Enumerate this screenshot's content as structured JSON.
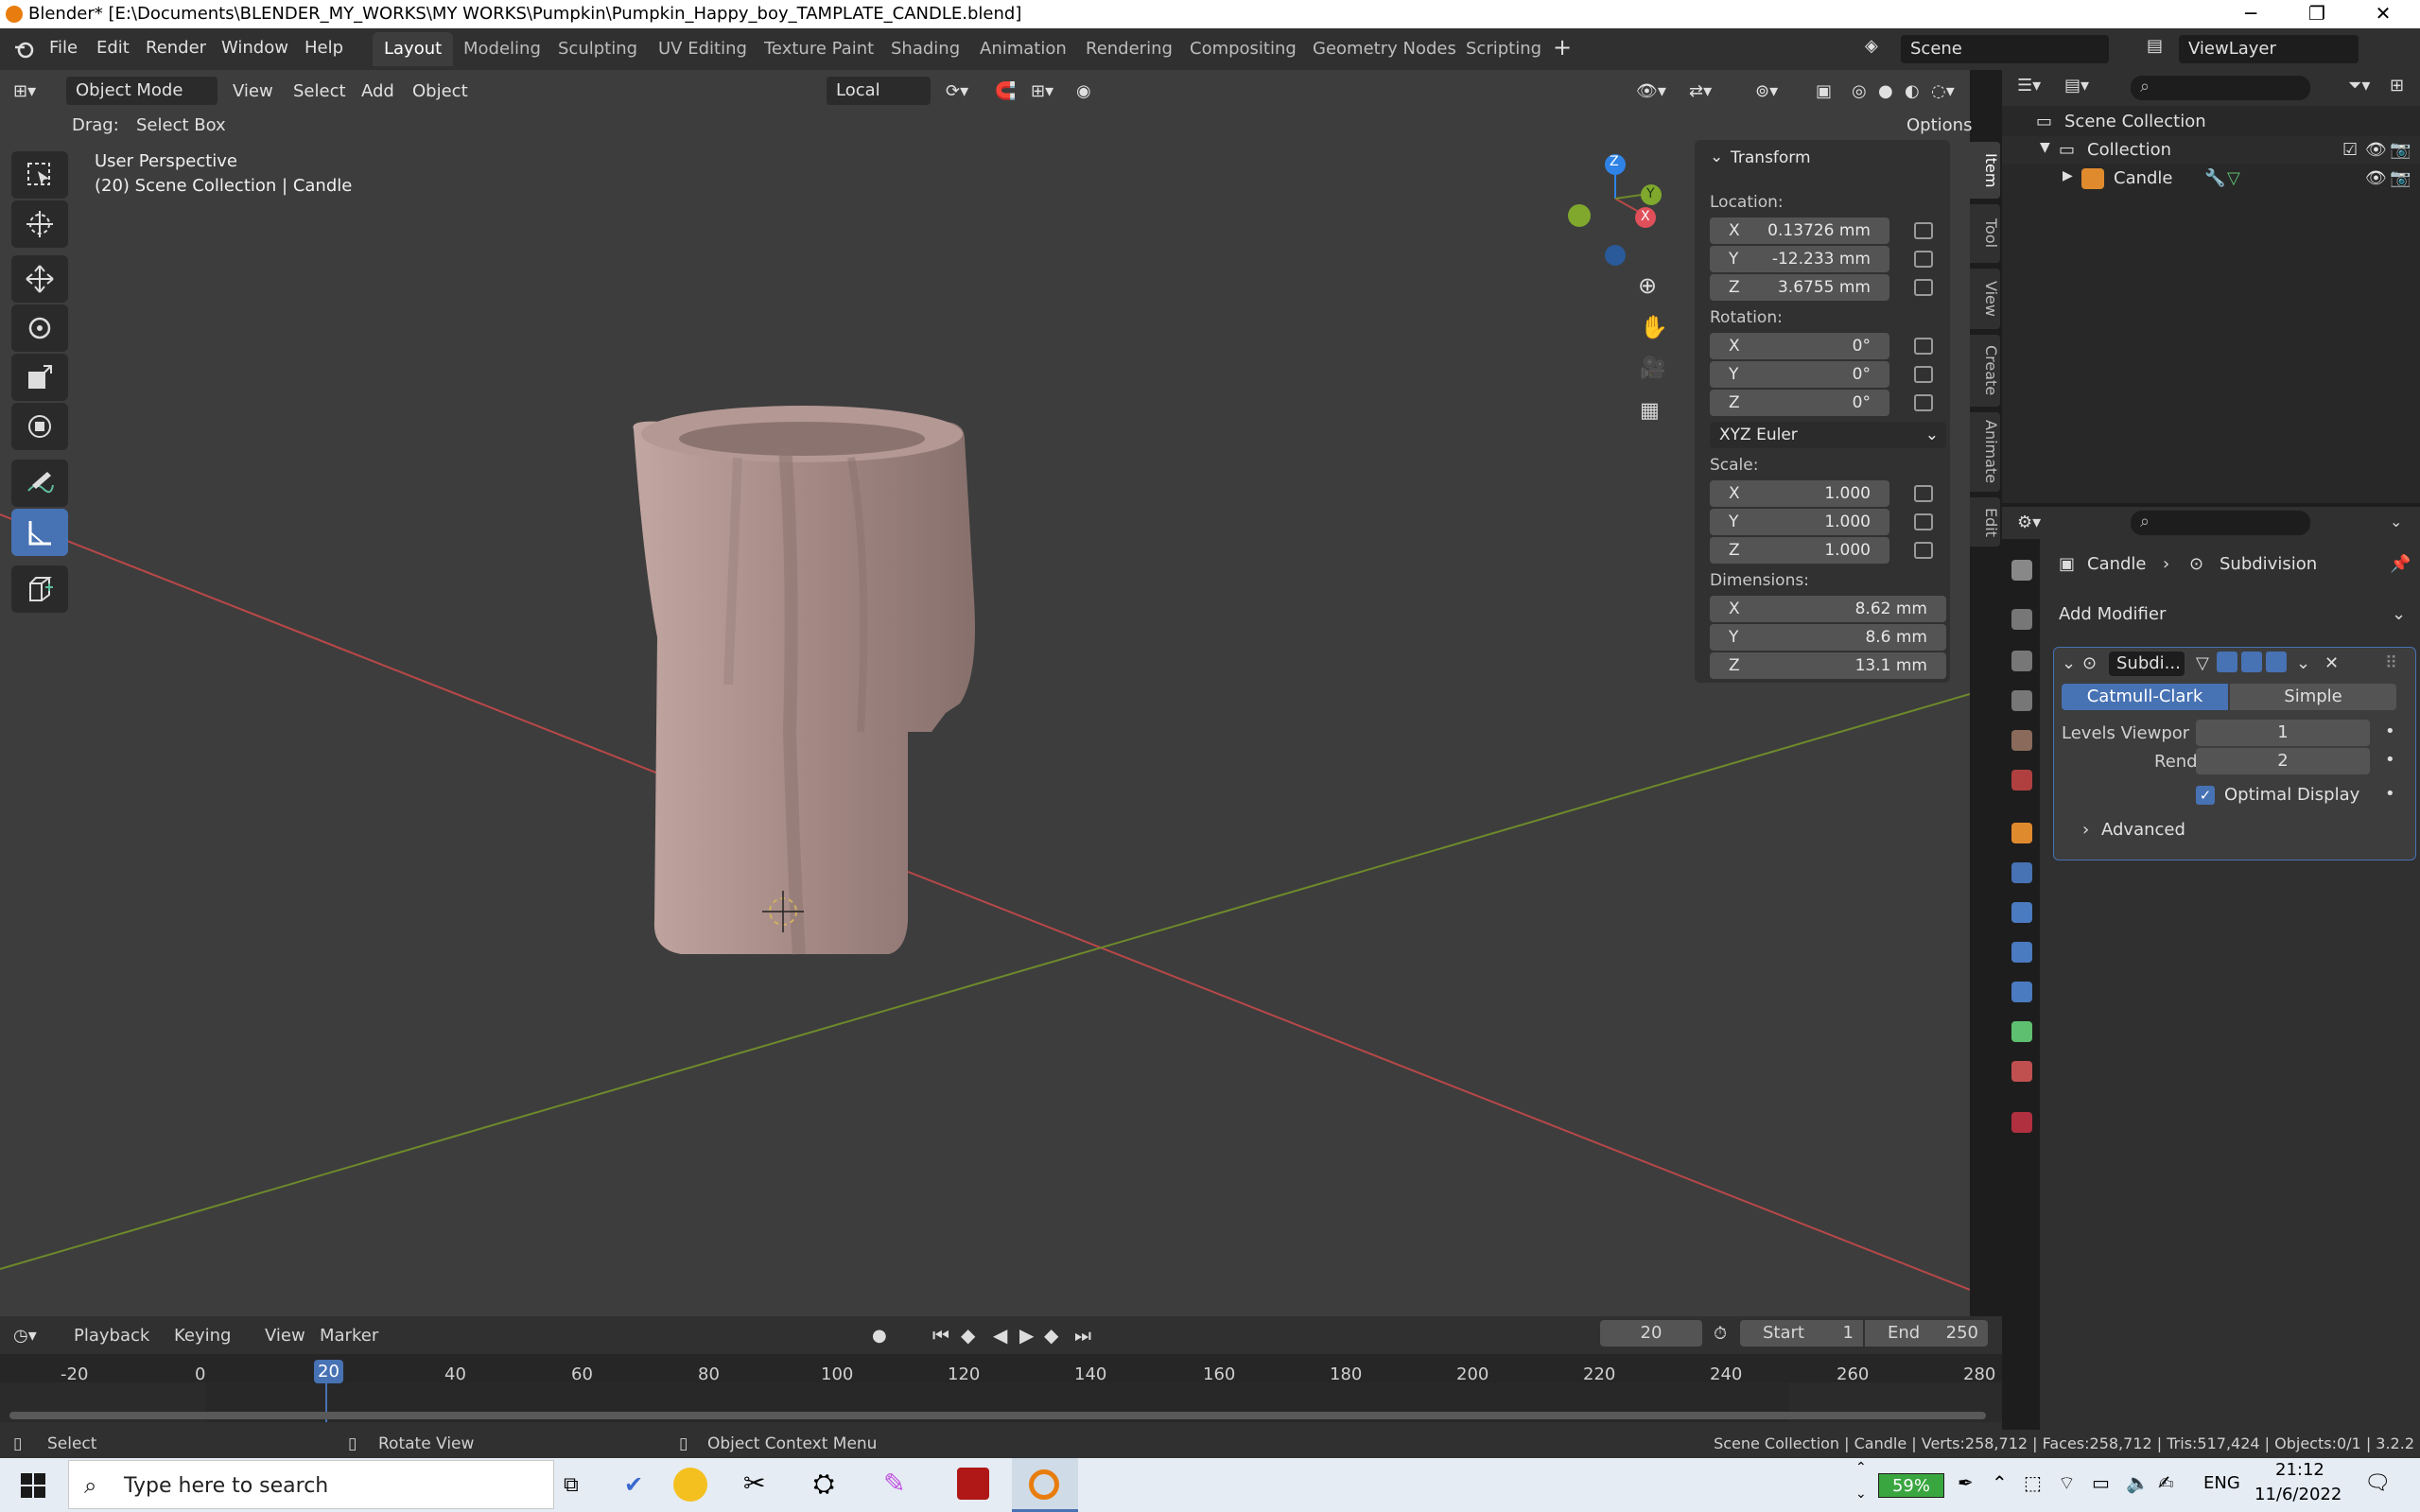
{
  "window": {
    "title": "Blender* [E:\\Documents\\BLENDER_MY_WORKS\\MY WORKS\\Pumpkin\\Pumpkin_Happy_boy_TAMPLATE_CANDLE.blend]"
  },
  "menu": [
    "File",
    "Edit",
    "Render",
    "Window",
    "Help"
  ],
  "workspaces": [
    "Layout",
    "Modeling",
    "Sculpting",
    "UV Editing",
    "Texture Paint",
    "Shading",
    "Animation",
    "Rendering",
    "Compositing",
    "Geometry Nodes",
    "Scripting"
  ],
  "active_workspace": "Layout",
  "scene": "Scene",
  "view_layer": "ViewLayer",
  "viewport_header": {
    "mode": "Object Mode",
    "menus": [
      "View",
      "Select",
      "Add",
      "Object"
    ],
    "transform_orientation": "Local",
    "drag_label": "Drag:",
    "drag_value": "Select Box",
    "options": "Options"
  },
  "viewport": {
    "perspective": "User Perspective",
    "collection_info": "(20) Scene Collection | Candle",
    "gizmo": {
      "z": "Z",
      "y": "Y",
      "x": "X"
    }
  },
  "transform_panel": {
    "title": "Transform",
    "location_label": "Location:",
    "location": {
      "x": "0.13726 mm",
      "y": "-12.233 mm",
      "z": "3.6755 mm"
    },
    "rotation_label": "Rotation:",
    "rotation": {
      "x": "0°",
      "y": "0°",
      "z": "0°"
    },
    "rotation_mode": "XYZ Euler",
    "scale_label": "Scale:",
    "scale": {
      "x": "1.000",
      "y": "1.000",
      "z": "1.000"
    },
    "dimensions_label": "Dimensions:",
    "dimensions": {
      "x": "8.62 mm",
      "y": "8.6 mm",
      "z": "13.1 mm"
    },
    "axes": [
      "X",
      "Y",
      "Z"
    ]
  },
  "sidebar_tabs": [
    "Item",
    "Tool",
    "View",
    "Create",
    "Animate",
    "Edit"
  ],
  "outliner": {
    "root": "Scene Collection",
    "collection": "Collection",
    "object": "Candle"
  },
  "properties": {
    "breadcrumb_object": "Candle",
    "breadcrumb_modifier": "Subdivision",
    "add_modifier": "Add Modifier",
    "modifier_name": "Subdi...",
    "catmull_clark": "Catmull-Clark",
    "simple": "Simple",
    "levels_viewport_label": "Levels Viewpor",
    "levels_viewport": "1",
    "render_label": "Render",
    "render": "2",
    "optimal_display": "Optimal Display",
    "advanced": "Advanced"
  },
  "timeline": {
    "menus": [
      "Playback",
      "Keying",
      "View",
      "Marker"
    ],
    "current_frame": "20",
    "start_label": "Start",
    "start": "1",
    "end_label": "End",
    "end": "250",
    "ruler": [
      "-20",
      "0",
      "20",
      "40",
      "60",
      "80",
      "100",
      "120",
      "140",
      "160",
      "180",
      "200",
      "220",
      "240",
      "260",
      "280"
    ]
  },
  "statusbar": {
    "select": "Select",
    "rotate": "Rotate View",
    "context": "Object Context Menu",
    "stats": "Scene Collection | Candle | Verts:258,712 | Faces:258,712 | Tris:517,424 | Objects:0/1 | 3.2.2"
  },
  "taskbar": {
    "search_placeholder": "Type here to search",
    "battery": "59%",
    "language": "ENG",
    "time": "21:12",
    "date": "11/6/2022"
  },
  "colors": {
    "accent": "#4772b3",
    "viewport_bg": "#3d3d3d",
    "x_axis": "#b84848",
    "y_axis": "#6e8a2b",
    "z_gizmo": "#2f83e6"
  }
}
